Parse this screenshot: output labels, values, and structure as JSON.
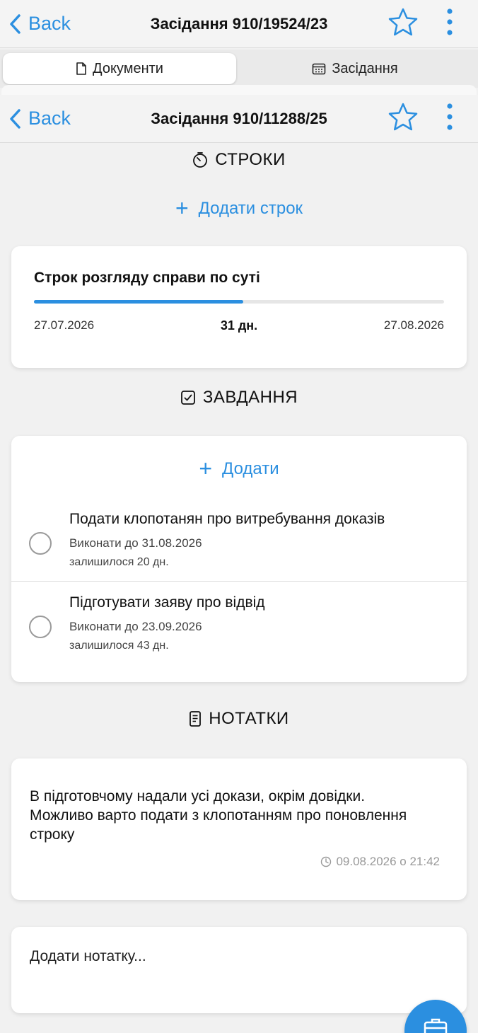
{
  "nav_top": {
    "back_label": "Back",
    "title": "Засідання 910/19524/23"
  },
  "tabs": [
    {
      "label": "Документи"
    },
    {
      "label": "Засідання"
    }
  ],
  "nav_inner": {
    "back_label": "Back",
    "title": "Засідання 910/11288/25"
  },
  "deadlines": {
    "heading": "СТРОКИ",
    "add_label": "Додати строк",
    "item": {
      "title": "Строк розгляду справи по суті",
      "start_date": "27.07.2026",
      "duration": "31 дн.",
      "end_date": "27.08.2026",
      "progress_fraction": 0.51
    }
  },
  "tasks": {
    "heading": "ЗАВДАННЯ",
    "add_label": "Додати",
    "items": [
      {
        "title": "Подати клопотанян про витребування доказів",
        "due": "Виконати до 31.08.2026",
        "remaining": "залишилося 20 дн."
      },
      {
        "title": "Підготувати заяву про відвід",
        "due": "Виконати до 23.09.2026",
        "remaining": "залишилося 43 дн."
      }
    ]
  },
  "notes": {
    "heading": "НОТАТКИ",
    "items": [
      {
        "text": "В підготовчому надали усі докази, окрім довідки. Можливо варто подати з клопотанням про поновлення строку",
        "timestamp": "09.08.2026 о 21:42"
      }
    ],
    "input_placeholder": "Додати нотатку..."
  },
  "colors": {
    "accent": "#2b8fe0",
    "background": "#f1f1f1"
  }
}
